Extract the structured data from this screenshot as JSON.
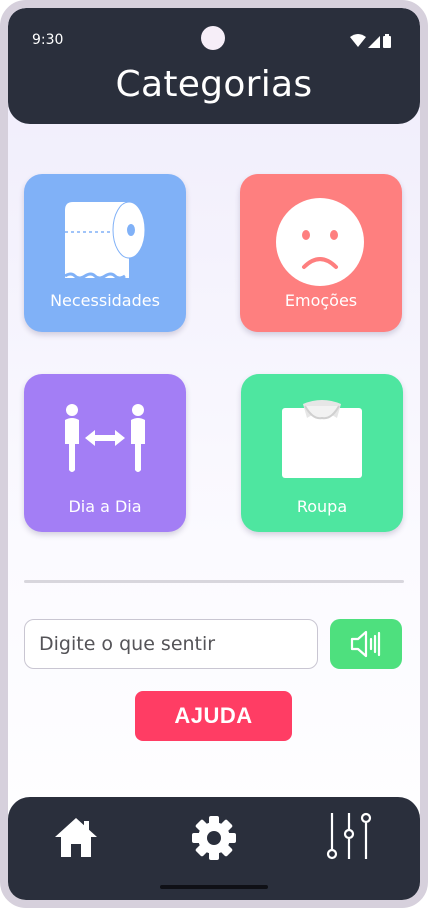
{
  "status_bar": {
    "time": "9:30"
  },
  "header": {
    "title": "Categorias"
  },
  "categories": [
    {
      "label": "Necessidades",
      "icon": "toilet-paper-icon",
      "color": "#80b1f7"
    },
    {
      "label": "Emoções",
      "icon": "sad-face-icon",
      "color": "#fe7f7f"
    },
    {
      "label": "Dia a Dia",
      "icon": "people-distance-icon",
      "color": "#a37ef5"
    },
    {
      "label": "Roupa",
      "icon": "shirt-icon",
      "color": "#4ee6a0"
    }
  ],
  "input": {
    "placeholder": "Digite o que sentir",
    "value": ""
  },
  "speak_button": {
    "icon": "speaker-icon",
    "color": "#4ee07e"
  },
  "help_button": {
    "label": "AJUDA",
    "color": "#ff3d64"
  },
  "bottom_nav": [
    {
      "icon": "home-icon"
    },
    {
      "icon": "gear-icon"
    },
    {
      "icon": "sliders-icon"
    }
  ]
}
